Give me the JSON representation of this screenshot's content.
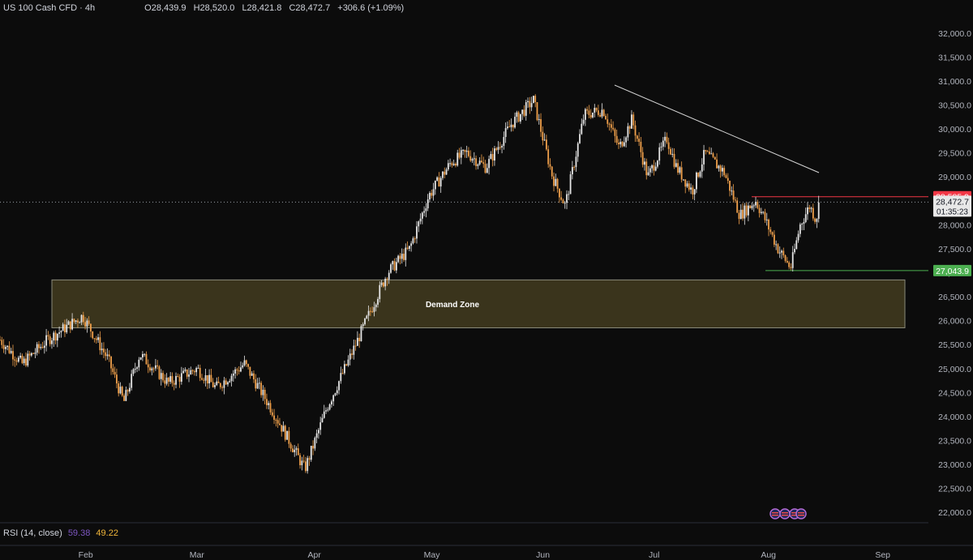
{
  "header": {
    "symbol": "US 100 Cash CFD · 4h",
    "open": "O28,439.9",
    "high": "H28,520.0",
    "low": "L28,421.8",
    "close": "C28,472.7",
    "change": "+306.6 (+1.09%)"
  },
  "rsi": {
    "label": "RSI (14, close)",
    "value1": "59.38",
    "value2": "49.22"
  },
  "badges": {
    "resistance": "28,585.9",
    "current": "28,472.7",
    "countdown": "01:35:23",
    "support": "27,043.9"
  },
  "zone_label": "Demand Zone",
  "colors": {
    "background": "#0c0c0c",
    "candle_up": "#e6e6e6",
    "candle_down": "#f0a04b",
    "zone_fill": "#3a341c",
    "resistance": "#f23645",
    "support": "#4caf50"
  },
  "chart_data": {
    "type": "line",
    "title": "",
    "ylim": [
      21750,
      32250
    ],
    "y_ticks": [
      "32,000.0",
      "31,500.0",
      "31,000.0",
      "30,500.0",
      "30,000.0",
      "29,500.0",
      "29,000.0",
      "28,500.0",
      "28,000.0",
      "27,500.0",
      "27,000.0",
      "26,500.0",
      "26,000.0",
      "25,500.0",
      "25,000.0",
      "24,500.0",
      "24,000.0",
      "23,500.0",
      "23,000.0",
      "22,500.0",
      "22,000.0"
    ],
    "x_ticks": [
      "Feb",
      "Mar",
      "Apr",
      "May",
      "Jun",
      "Jul",
      "Aug",
      "Sep"
    ],
    "series": [
      {
        "values": [
          {
            "date": "2025-01-01",
            "price": 25600
          },
          {
            "date": "2025-01-08",
            "price": 25100
          },
          {
            "date": "2025-01-16",
            "price": 25600
          },
          {
            "date": "2025-01-27",
            "price": 26100
          },
          {
            "date": "2025-02-04",
            "price": 25200
          },
          {
            "date": "2025-02-09",
            "price": 24300
          },
          {
            "date": "2025-02-14",
            "price": 25300
          },
          {
            "date": "2025-02-23",
            "price": 24700
          },
          {
            "date": "2025-03-04",
            "price": 25000
          },
          {
            "date": "2025-03-10",
            "price": 24600
          },
          {
            "date": "2025-03-19",
            "price": 25100
          },
          {
            "date": "2025-03-28",
            "price": 24100
          },
          {
            "date": "2025-04-07",
            "price": 22900
          },
          {
            "date": "2025-04-14",
            "price": 24200
          },
          {
            "date": "2025-04-21",
            "price": 25200
          },
          {
            "date": "2025-04-27",
            "price": 26100
          },
          {
            "date": "2025-05-03",
            "price": 27000
          },
          {
            "date": "2025-05-10",
            "price": 27500
          },
          {
            "date": "2025-05-16",
            "price": 28600
          },
          {
            "date": "2025-05-23",
            "price": 29300
          },
          {
            "date": "2025-05-28",
            "price": 29500
          },
          {
            "date": "2025-06-03",
            "price": 29200
          },
          {
            "date": "2025-06-11",
            "price": 30100
          },
          {
            "date": "2025-06-18",
            "price": 30600
          },
          {
            "date": "2025-06-24",
            "price": 29000
          },
          {
            "date": "2025-06-28",
            "price": 28400
          },
          {
            "date": "2025-07-04",
            "price": 30300
          },
          {
            "date": "2025-07-10",
            "price": 30400
          },
          {
            "date": "2025-07-15",
            "price": 29600
          },
          {
            "date": "2025-07-19",
            "price": 30200
          },
          {
            "date": "2025-07-24",
            "price": 29000
          },
          {
            "date": "2025-07-30",
            "price": 29800
          },
          {
            "date": "2025-08-02",
            "price": 29200
          },
          {
            "date": "2025-08-07",
            "price": 28700
          },
          {
            "date": "2025-08-11",
            "price": 29500
          },
          {
            "date": "2025-08-17",
            "price": 29100
          },
          {
            "date": "2025-08-22",
            "price": 28200
          },
          {
            "date": "2025-08-27",
            "price": 28500
          },
          {
            "date": "2025-08-30",
            "price": 28100
          },
          {
            "date": "2025-09-03",
            "price": 27500
          },
          {
            "date": "2025-09-07",
            "price": 27100
          },
          {
            "date": "2025-09-10",
            "price": 28000
          },
          {
            "date": "2025-09-13",
            "price": 28400
          },
          {
            "date": "2025-09-15",
            "price": 28100
          },
          {
            "date": "2025-09-16",
            "price": 28473
          }
        ]
      }
    ],
    "demand_zone": {
      "start": "2025-01-27",
      "end": "2025-10-14",
      "top": 26850,
      "bottom": 25850
    },
    "trendline": {
      "start": {
        "date": "2025-07-13",
        "price": 30680
      },
      "end": {
        "date": "2025-09-30",
        "price": 28880
      }
    },
    "resistance_level": 28585.9,
    "current_price": 28472.7,
    "support_level": 27043.9,
    "x_tick_dates": [
      "2025-01-28",
      "2025-03-04",
      "2025-04-10",
      "2025-05-17",
      "2025-06-21",
      "2025-07-26",
      "2025-08-31",
      "2025-10-06"
    ]
  }
}
